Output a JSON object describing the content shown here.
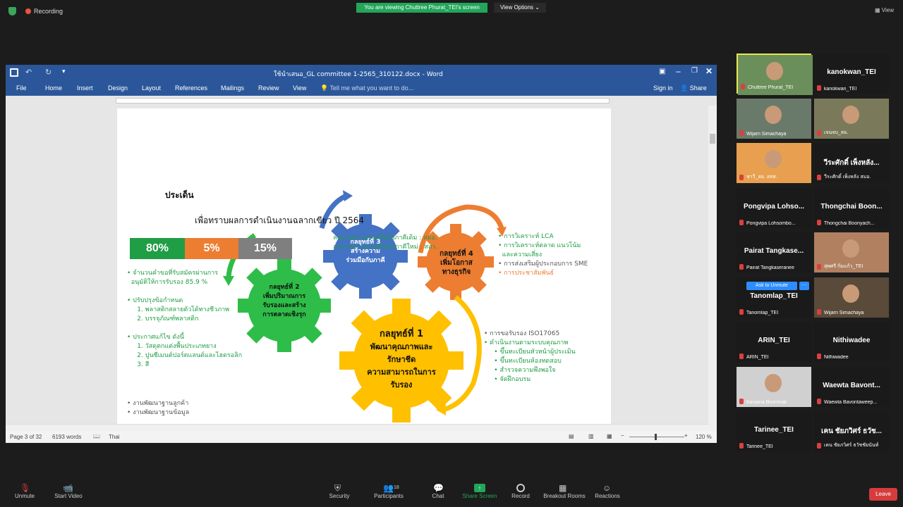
{
  "top": {
    "recording": "Recording",
    "viewing": "You are viewing Chuttree Phurat_TEI's screen",
    "view_options": "View Options",
    "view": "View"
  },
  "word": {
    "title": "ใช้นำเสนอ_GL committee 1-2565_310122.docx - Word",
    "tabs": [
      "File",
      "Home",
      "Insert",
      "Design",
      "Layout",
      "References",
      "Mailings",
      "Review",
      "View"
    ],
    "tell_me": "Tell me what you want to do...",
    "sign_in": "Sign in",
    "share": "Share",
    "status": {
      "page": "Page 3 of 32",
      "words": "6193 words",
      "lang": "Thai",
      "zoom": "120 %"
    }
  },
  "doc": {
    "heading": "ประเด็น",
    "subheading": "เพื่อทราบผลการดำเนินงานฉลากเขียว ปี 2564",
    "percents": [
      {
        "label": "80%",
        "color": "#1f9e45"
      },
      {
        "label": "5%",
        "color": "#ed7d31"
      },
      {
        "label": "15%",
        "color": "#7f7f7f"
      }
    ],
    "top_note": [
      "ลงนามความร่วมมือกับภาคีเดิม : สมอ.",
      "ลงนามความร่วมมือกับภาคีใหม่ : สสว."
    ],
    "gear1": {
      "title": "กลยุทธ์ที่ 1",
      "lines": [
        "พัฒนาคุณภาพและ",
        "รักษาชีด",
        "ความสามารถในการ",
        "รับรอง"
      ]
    },
    "gear2": {
      "title": "กลยุทธ์ที่ 2",
      "lines": [
        "เพิ่มปริมาณการ",
        "รับรองและสร้าง",
        "การตลาดเชิงรุก"
      ]
    },
    "gear3": {
      "title": "กลยุทธ์ที่ 3",
      "lines": [
        "สร้างความ",
        "ร่วมมือกับภาคี"
      ]
    },
    "gear4": {
      "title": "กลยุทธ์ที่ 4",
      "lines": [
        "เพิ่มโอกาส",
        "ทางธุรกิจ"
      ]
    },
    "left_list": [
      "• จำนวนคำขอที่รับสมัครผ่านการ",
      "  อนุมัติให้การรับรอง 85.9 %",
      "",
      "• ปรับปรุงข้อกำหนด",
      "     1. พลาสติกสลายตัวได้ทางชีวภาพ",
      "     2. บรรจุภัณฑ์พลาสติก",
      "",
      "• ประกาศแก้ไข ดังนี้",
      "     1. วัสดุตกแต่งพื้นประเภทยาง",
      "     2. ปูนซีเมนต์ปอร์ตแลนด์และไฮดรอลิก",
      "     3. สี"
    ],
    "left_list2": [
      "• งานพัฒนาฐานลูกค้า",
      "• งานพัฒนาฐานข้อมูล"
    ],
    "right_list": [
      {
        "text": "• การวิเคราะห์ LCA",
        "color": "#1f9e45"
      },
      {
        "text": "• การวิเคราะห์ตลาด แนวโน้ม",
        "color": "#1f9e45"
      },
      {
        "text": "  และความเสี่ยง",
        "color": "#1f9e45"
      },
      {
        "text": "• การส่งเสริมผู้ประกอบการ SME",
        "color": "#555555"
      },
      {
        "text": "• การประชาสัมพันธ์",
        "color": "#ed7d31"
      }
    ],
    "bottom_right_list": [
      {
        "text": "• การขอรับรอง ISO17065",
        "color": "#555555"
      },
      {
        "text": "• ดำเนินงานตามระบบคุณภาพ",
        "color": "#1f9e45"
      },
      {
        "text": "     • ขึ้นทะเบียนหัวหน้าผู้ประเมิน",
        "color": "#1f9e45"
      },
      {
        "text": "     • ขึ้นทะเบียนห้องทดสอบ",
        "color": "#1f9e45"
      },
      {
        "text": "     • สำรวจความพึงพอใจ",
        "color": "#1f9e45"
      },
      {
        "text": "     • จัดฝึกอบรม",
        "color": "#1f9e45"
      }
    ]
  },
  "participants": [
    {
      "name": "",
      "label": "Chuttree Phurat_TEI",
      "video": true
    },
    {
      "name": "kanokwan_TEI",
      "label": "kanokwan_TEI",
      "video": false
    },
    {
      "name": "",
      "label": "Wijarn Simachaya",
      "video": true
    },
    {
      "name": "",
      "label": "เจนจบ_สอ.",
      "video": true
    },
    {
      "name": "",
      "label": "ชาวี_สอ. สสส.",
      "video": true
    },
    {
      "name": "วีระศักดิ์ เพ็งหลัง...",
      "label": "วีระศักดิ์ เพ็งหลัง สมอ.",
      "video": false
    },
    {
      "name": "Pongvipa Lohso...",
      "label": "Pongvipa Lohsombo...",
      "video": false
    },
    {
      "name": "Thongchai Boon...",
      "label": "Thongchai Boonyach...",
      "video": false
    },
    {
      "name": "Pairat Tangkase...",
      "label": "Pairat Tangkaseranee",
      "video": false
    },
    {
      "name": "",
      "label": "สุพศรี กิ่มแก้ว_TEI",
      "video": true
    },
    {
      "name": "Tanomlap_TEI",
      "label": "Tanomlap_TEI",
      "video": false
    },
    {
      "name": "",
      "label": "Wijarn Simachaya",
      "video": true
    },
    {
      "name": "ARIN_TEI",
      "label": "ARIN_TEI",
      "video": false
    },
    {
      "name": "Nithiwadee",
      "label": "Nithiwadee",
      "video": false
    },
    {
      "name": "",
      "label": "Kanjana Boonmak",
      "video": true
    },
    {
      "name": "Waewta Bavont...",
      "label": "Waewta Bavontaweep...",
      "video": false
    },
    {
      "name": "Tarinee_TEI",
      "label": "Tarinee_TEI",
      "video": false
    },
    {
      "name": "เคน ชัยภวิศร์ ธวัช...",
      "label": "เคน ชัยภวิศร์ ธวัชชัยนันท์",
      "video": false
    }
  ],
  "ask_unmute": "Ask to Unmute",
  "bottom": {
    "unmute": "Unmute",
    "start_video": "Start Video",
    "security": "Security",
    "participants": "Participants",
    "participant_count": "18",
    "chat": "Chat",
    "share_screen": "Share Screen",
    "record": "Record",
    "breakout": "Breakout Rooms",
    "reactions": "Reactions",
    "leave": "Leave"
  }
}
